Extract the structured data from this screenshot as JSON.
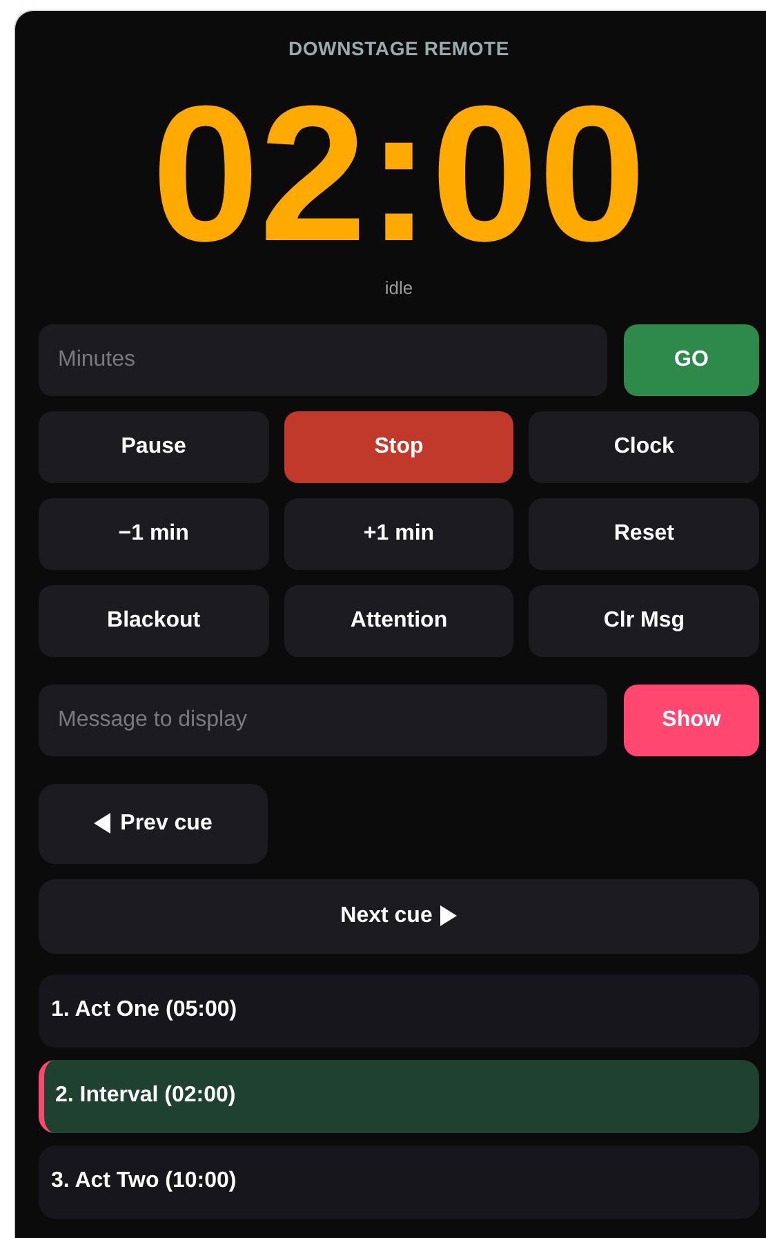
{
  "title": "DOWNSTAGE REMOTE",
  "timer": "02:00",
  "status": "idle",
  "minutes_field": {
    "placeholder": "Minutes"
  },
  "go_button": "GO",
  "controls": [
    {
      "label": "Pause",
      "kind": "normal"
    },
    {
      "label": "Stop",
      "kind": "danger"
    },
    {
      "label": "Clock",
      "kind": "normal"
    },
    {
      "label": "−1 min",
      "kind": "normal"
    },
    {
      "label": "+1 min",
      "kind": "normal"
    },
    {
      "label": "Reset",
      "kind": "normal"
    },
    {
      "label": "Blackout",
      "kind": "normal"
    },
    {
      "label": "Attention",
      "kind": "normal"
    },
    {
      "label": "Clr Msg",
      "kind": "normal"
    }
  ],
  "message_field": {
    "placeholder": "Message to display"
  },
  "show_button": "Show",
  "prev_cue": "Prev cue",
  "next_cue": "Next cue",
  "cues": [
    {
      "label": "1. Act One (05:00)",
      "selected": false
    },
    {
      "label": "2. Interval (02:00)",
      "selected": true
    },
    {
      "label": "3. Act Two (10:00)",
      "selected": false
    }
  ]
}
